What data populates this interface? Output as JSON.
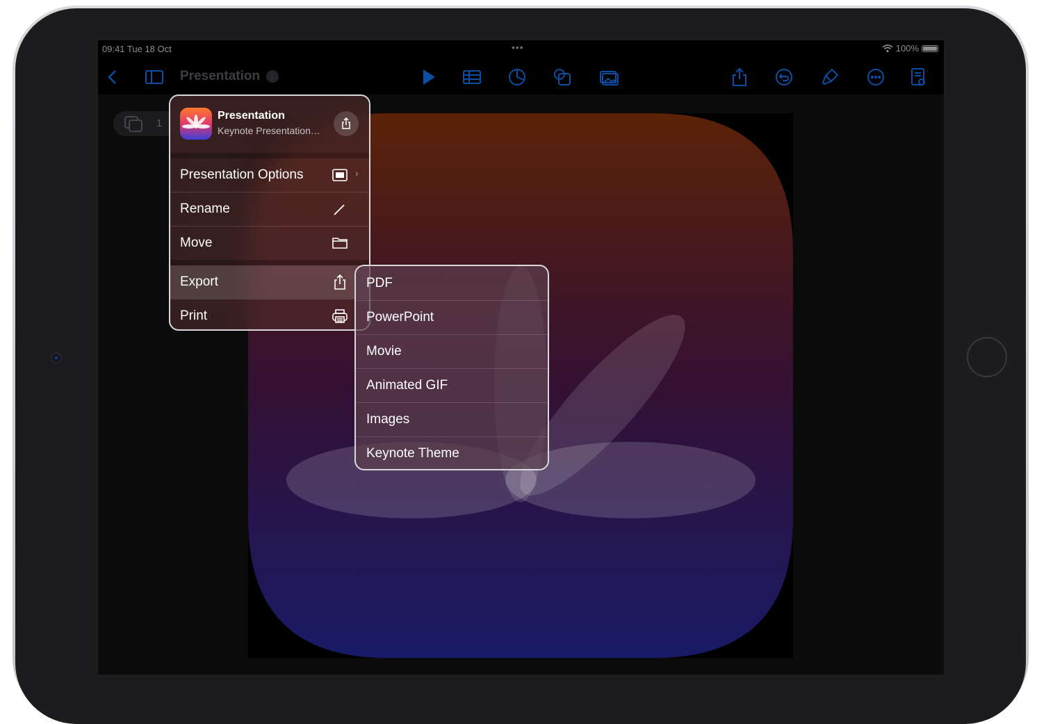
{
  "status_bar": {
    "time": "09:41  Tue 18 Oct",
    "dots": "•••",
    "battery": "100%"
  },
  "toolbar": {
    "title": "Presentation",
    "title_chevron": "⌄",
    "left_icons": [
      "chevron-left-icon",
      "sidebar-icon"
    ],
    "center_icons": [
      "play-icon",
      "table-icon",
      "chart-icon",
      "shapes-icon",
      "media-icon"
    ],
    "right_icons": [
      "share-icon",
      "undo-icon",
      "format-brush-icon",
      "more-icon",
      "document-icon"
    ]
  },
  "navigator": {
    "count": "1"
  },
  "file_menu": {
    "header": {
      "title": "Presentation",
      "subtitle": "Keynote Presentation…"
    },
    "items": [
      {
        "label": "Presentation Options",
        "icon": "presentation-screen-icon",
        "has_submenu": true
      },
      {
        "label": "Rename",
        "icon": "pencil-icon"
      },
      {
        "label": "Move",
        "icon": "folder-icon"
      },
      {
        "label": "Export",
        "icon": "export-icon",
        "active": true
      },
      {
        "label": "Print",
        "icon": "printer-icon"
      }
    ]
  },
  "export_submenu": {
    "items": [
      "PDF",
      "PowerPoint",
      "Movie",
      "Animated GIF",
      "Images",
      "Keynote Theme"
    ]
  },
  "colors": {
    "toolbar_tint": "#0a4fa3",
    "slide_top": "#5a2208",
    "slide_bottom": "#181a66"
  }
}
